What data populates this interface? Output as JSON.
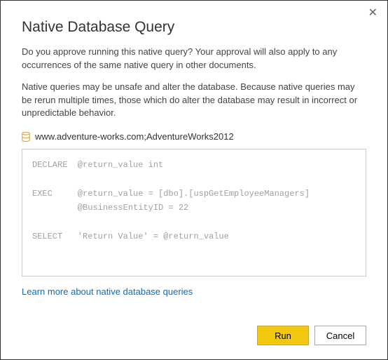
{
  "dialog": {
    "title": "Native Database Query",
    "close_label": "✕",
    "paragraph1": "Do you approve running this native query? Your approval will also apply to any occurrences of the same native query in other documents.",
    "paragraph2": "Native queries may be unsafe and alter the database. Because native queries may be rerun multiple times, those which do alter the database may result in incorrect or unpredictable behavior.",
    "source": "www.adventure-works.com;AdventureWorks2012",
    "query_text": "DECLARE  @return_value int\n\nEXEC     @return_value = [dbo].[uspGetEmployeeManagers]\n         @BusinessEntityID = 22\n\nSELECT   'Return Value' = @return_value",
    "learn_more": "Learn more about native database queries",
    "run_label": "Run",
    "cancel_label": "Cancel"
  }
}
